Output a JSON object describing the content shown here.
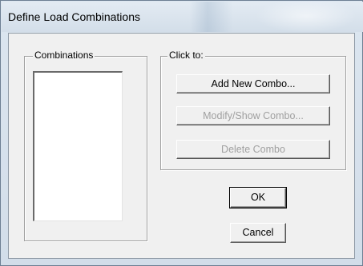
{
  "window": {
    "title": "Define Load Combinations"
  },
  "combinations": {
    "label": "Combinations",
    "items": []
  },
  "click_to": {
    "label": "Click to:",
    "add_label": "Add New Combo...",
    "modify_label": "Modify/Show Combo...",
    "delete_label": "Delete Combo"
  },
  "dialog_buttons": {
    "ok_label": "OK",
    "cancel_label": "Cancel"
  }
}
